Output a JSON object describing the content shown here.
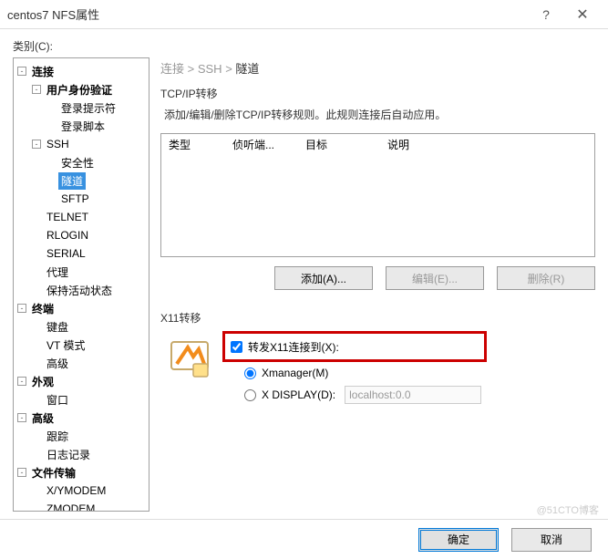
{
  "titlebar": {
    "title": "centos7 NFS属性",
    "help": "?",
    "close": "✕"
  },
  "category_label": "类别(C):",
  "tree": [
    {
      "d": 0,
      "label": "连接",
      "bold": true,
      "toggle": "-"
    },
    {
      "d": 1,
      "label": "用户身份验证",
      "bold": true,
      "toggle": "-"
    },
    {
      "d": 2,
      "label": "登录提示符",
      "toggle": ""
    },
    {
      "d": 2,
      "label": "登录脚本",
      "toggle": ""
    },
    {
      "d": 1,
      "label": "SSH",
      "toggle": "-"
    },
    {
      "d": 2,
      "label": "安全性",
      "toggle": ""
    },
    {
      "d": 2,
      "label": "隧道",
      "toggle": "",
      "sel": true
    },
    {
      "d": 2,
      "label": "SFTP",
      "toggle": ""
    },
    {
      "d": 1,
      "label": "TELNET",
      "toggle": ""
    },
    {
      "d": 1,
      "label": "RLOGIN",
      "toggle": ""
    },
    {
      "d": 1,
      "label": "SERIAL",
      "toggle": ""
    },
    {
      "d": 1,
      "label": "代理",
      "toggle": ""
    },
    {
      "d": 1,
      "label": "保持活动状态",
      "toggle": ""
    },
    {
      "d": 0,
      "label": "终端",
      "bold": true,
      "toggle": "-"
    },
    {
      "d": 1,
      "label": "键盘",
      "toggle": ""
    },
    {
      "d": 1,
      "label": "VT 模式",
      "toggle": ""
    },
    {
      "d": 1,
      "label": "高级",
      "toggle": ""
    },
    {
      "d": 0,
      "label": "外观",
      "bold": true,
      "toggle": "-"
    },
    {
      "d": 1,
      "label": "窗口",
      "toggle": ""
    },
    {
      "d": 0,
      "label": "高级",
      "bold": true,
      "toggle": "-"
    },
    {
      "d": 1,
      "label": "跟踪",
      "toggle": ""
    },
    {
      "d": 1,
      "label": "日志记录",
      "toggle": ""
    },
    {
      "d": 0,
      "label": "文件传输",
      "bold": true,
      "toggle": "-"
    },
    {
      "d": 1,
      "label": "X/YMODEM",
      "toggle": ""
    },
    {
      "d": 1,
      "label": "ZMODEM",
      "toggle": ""
    }
  ],
  "breadcrumb": {
    "p1": "连接",
    "sep": " > ",
    "p2": "SSH",
    "p3": "隧道"
  },
  "tcp": {
    "title": "TCP/IP转移",
    "help": "添加/编辑/删除TCP/IP转移规则。此规则连接后自动应用。",
    "col1": "类型",
    "col2": "侦听端...",
    "col3": "目标",
    "col4": "说明",
    "add": "添加(A)...",
    "edit": "编辑(E)...",
    "del": "删除(R)"
  },
  "x11": {
    "title": "X11转移",
    "forward": "转发X11连接到(X):",
    "xmanager": "Xmanager(M)",
    "xdisplay": "X DISPLAY(D):",
    "xdisplay_val": "localhost:0.0"
  },
  "footer": {
    "ok": "确定",
    "cancel": "取消"
  },
  "watermark": "@51CTO博客"
}
